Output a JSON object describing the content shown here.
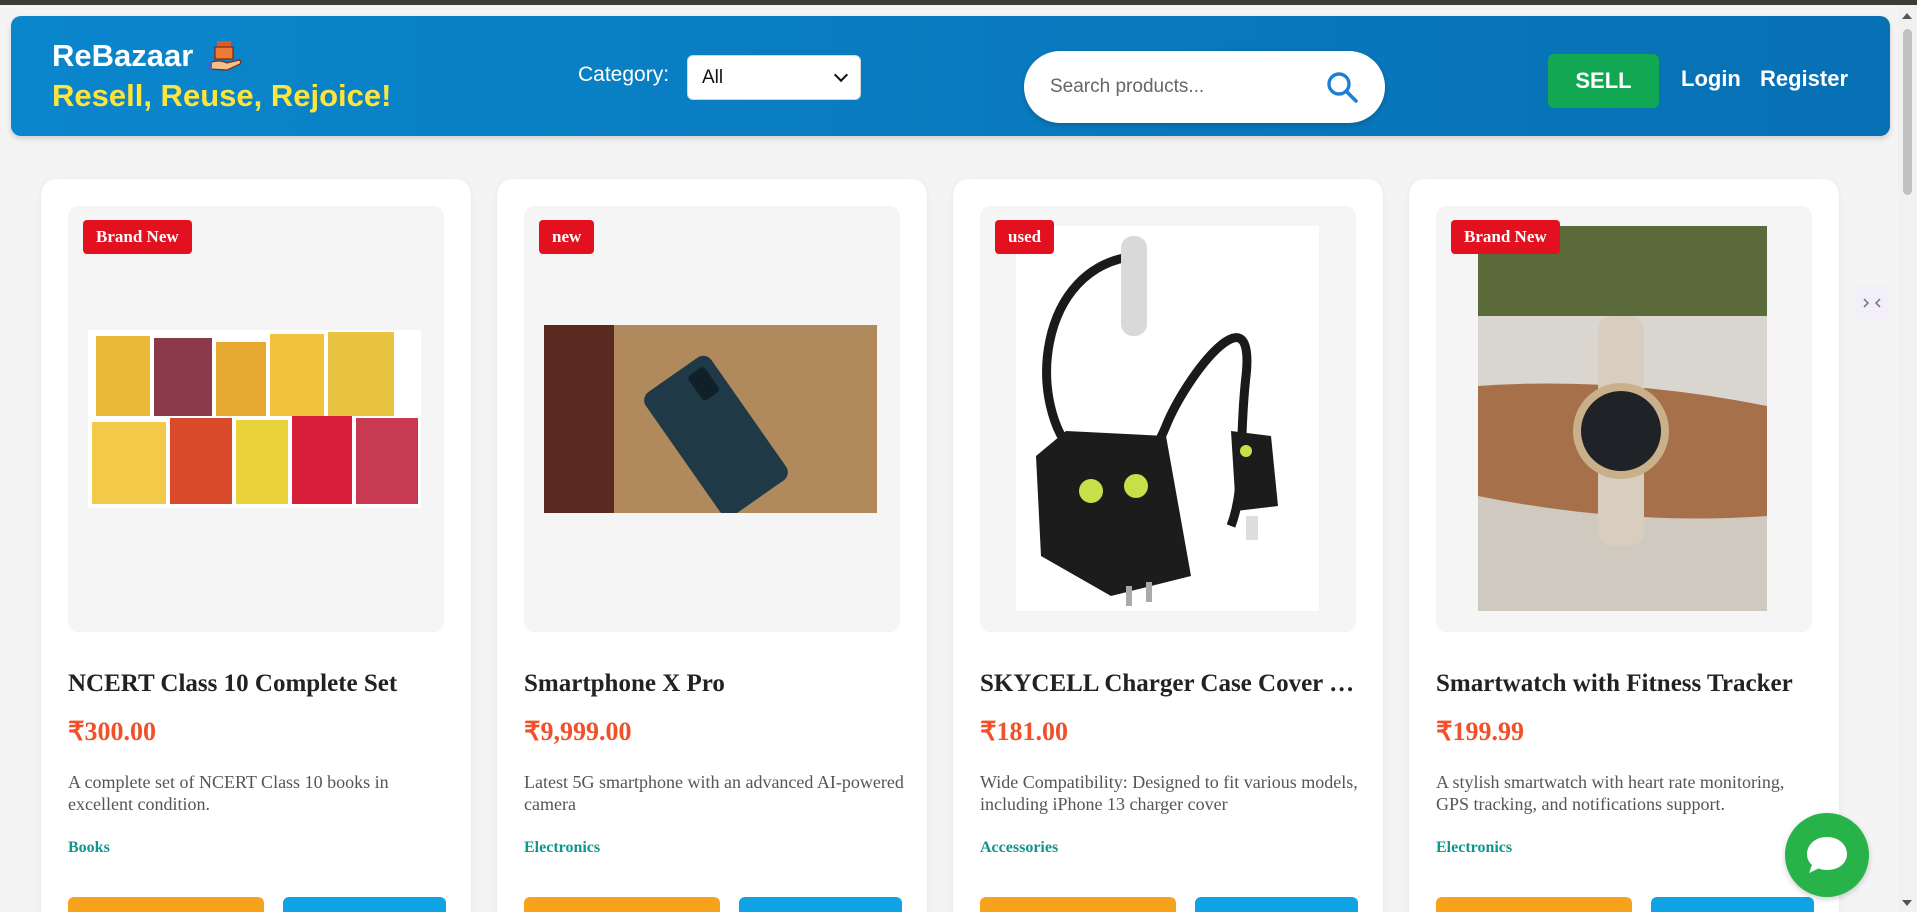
{
  "header": {
    "brand_name": "ReBazaar",
    "tagline": "Resell, Reuse, Rejoice!",
    "category_label": "Category:",
    "category_value": "All",
    "search_placeholder": "Search products...",
    "sell_label": "SELL",
    "login_label": "Login",
    "register_label": "Register"
  },
  "products": [
    {
      "badge": "Brand New",
      "title": "NCERT Class 10 Complete Set",
      "price": "₹300.00",
      "description": "A complete set of NCERT Class 10 books in excellent condition.",
      "category": "Books",
      "image": "books-photo"
    },
    {
      "badge": "new",
      "title": "Smartphone X Pro",
      "price": "₹9,999.00",
      "description": "Latest 5G smartphone with an advanced AI-powered camera",
      "category": "Electronics",
      "image": "phone-photo"
    },
    {
      "badge": "used",
      "title": "SKYCELL Charger Case Cover …",
      "price": "₹181.00",
      "description": "Wide Compatibility: Designed to fit various models, including iPhone 13 charger cover",
      "category": "Accessories",
      "image": "charger-cover-photo"
    },
    {
      "badge": "Brand New",
      "title": "Smartwatch with Fitness Tracker",
      "price": "₹199.99",
      "description": "A stylish smartwatch with heart rate monitoring, GPS tracking, and notifications support.",
      "category": "Electronics",
      "image": "smartwatch-photo"
    }
  ],
  "colors": {
    "header": "#0a86cc",
    "tagline": "#ffe43a",
    "sell": "#12a853",
    "badge": "#e3101f",
    "price": "#f0502a",
    "category": "#12958c",
    "chat": "#28b34a"
  }
}
